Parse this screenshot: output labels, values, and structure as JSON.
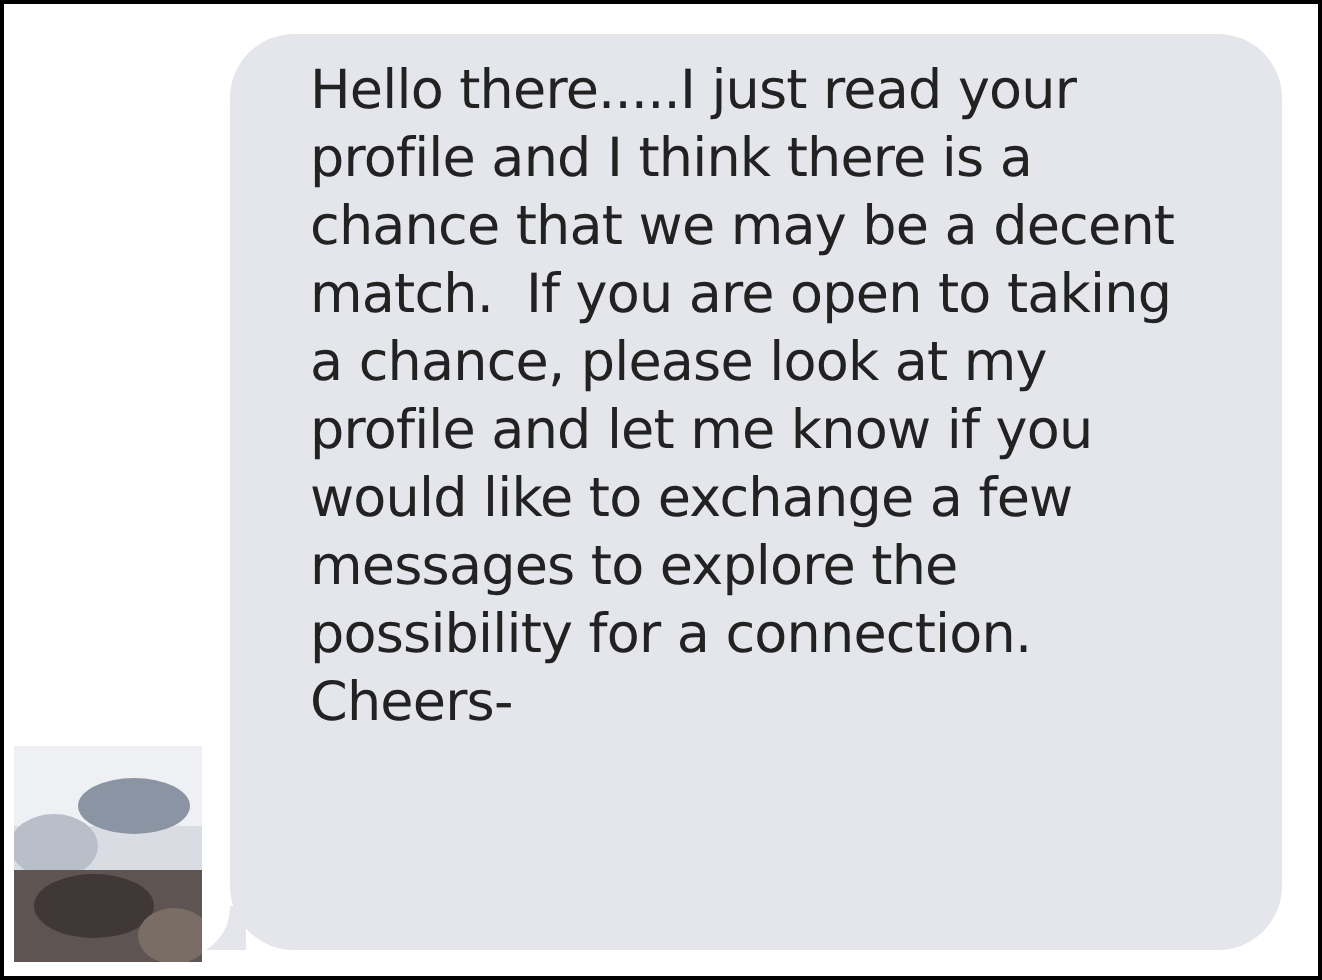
{
  "message": {
    "text": "Hello there.....I just read your\nprofile and I think there is a\nchance that we may be a decent\nmatch.  If you are open to taking\na chance, please look at my\nprofile and let me know if you\nwould like to exchange a few\nmessages to explore the\npossibility for a connection.\nCheers-"
  }
}
